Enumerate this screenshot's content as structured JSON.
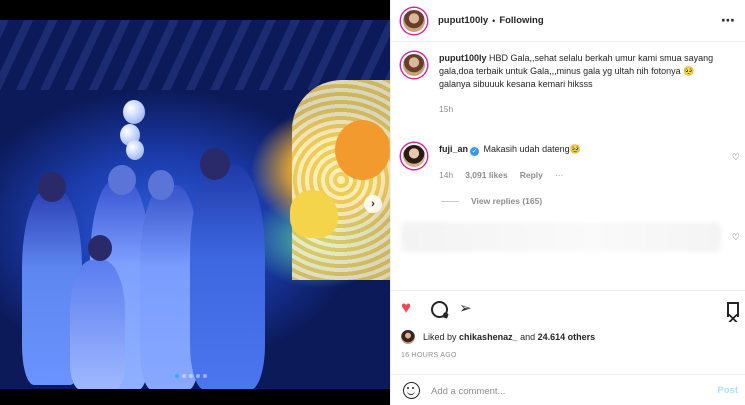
{
  "post": {
    "username": "puput100ly",
    "separator": "•",
    "follow_status": "Following",
    "more_icon": "more-horizontal-icon",
    "caption_line1": "HBD Gala,,sehat selalu berkah umur kami smua sayang gala,doa terbaik untuk Gala,,,minus gala yg ultah nih fotonya 🥺",
    "caption_line2": "galanya sibuuuk kesana kemari hiksss",
    "caption_time": "15h"
  },
  "comments": [
    {
      "username": "fuji_an",
      "verified": true,
      "text": "Makasih udah dateng🥹",
      "time": "14h",
      "likes": "3,091 likes",
      "reply_label": "Reply",
      "options": "···",
      "view_replies": "View replies (165)"
    }
  ],
  "actions": {
    "like_icon": "heart-filled-icon",
    "comment_icon": "comment-icon",
    "share_icon": "share-icon",
    "save_icon": "bookmark-icon",
    "like_color": "#ed4956"
  },
  "liked_by": {
    "prefix": "Liked by",
    "user": "chikashenaz_",
    "conjunction": "and",
    "others": "24.614 others"
  },
  "posted_ago": "16 HOURS AGO",
  "add_comment": {
    "placeholder": "Add a comment...",
    "post_label": "Post",
    "emoji_icon": "emoji-icon"
  },
  "carousel": {
    "total": 5,
    "active_index": 0,
    "next_icon": "chevron-right-icon",
    "next_glyph": "›"
  }
}
